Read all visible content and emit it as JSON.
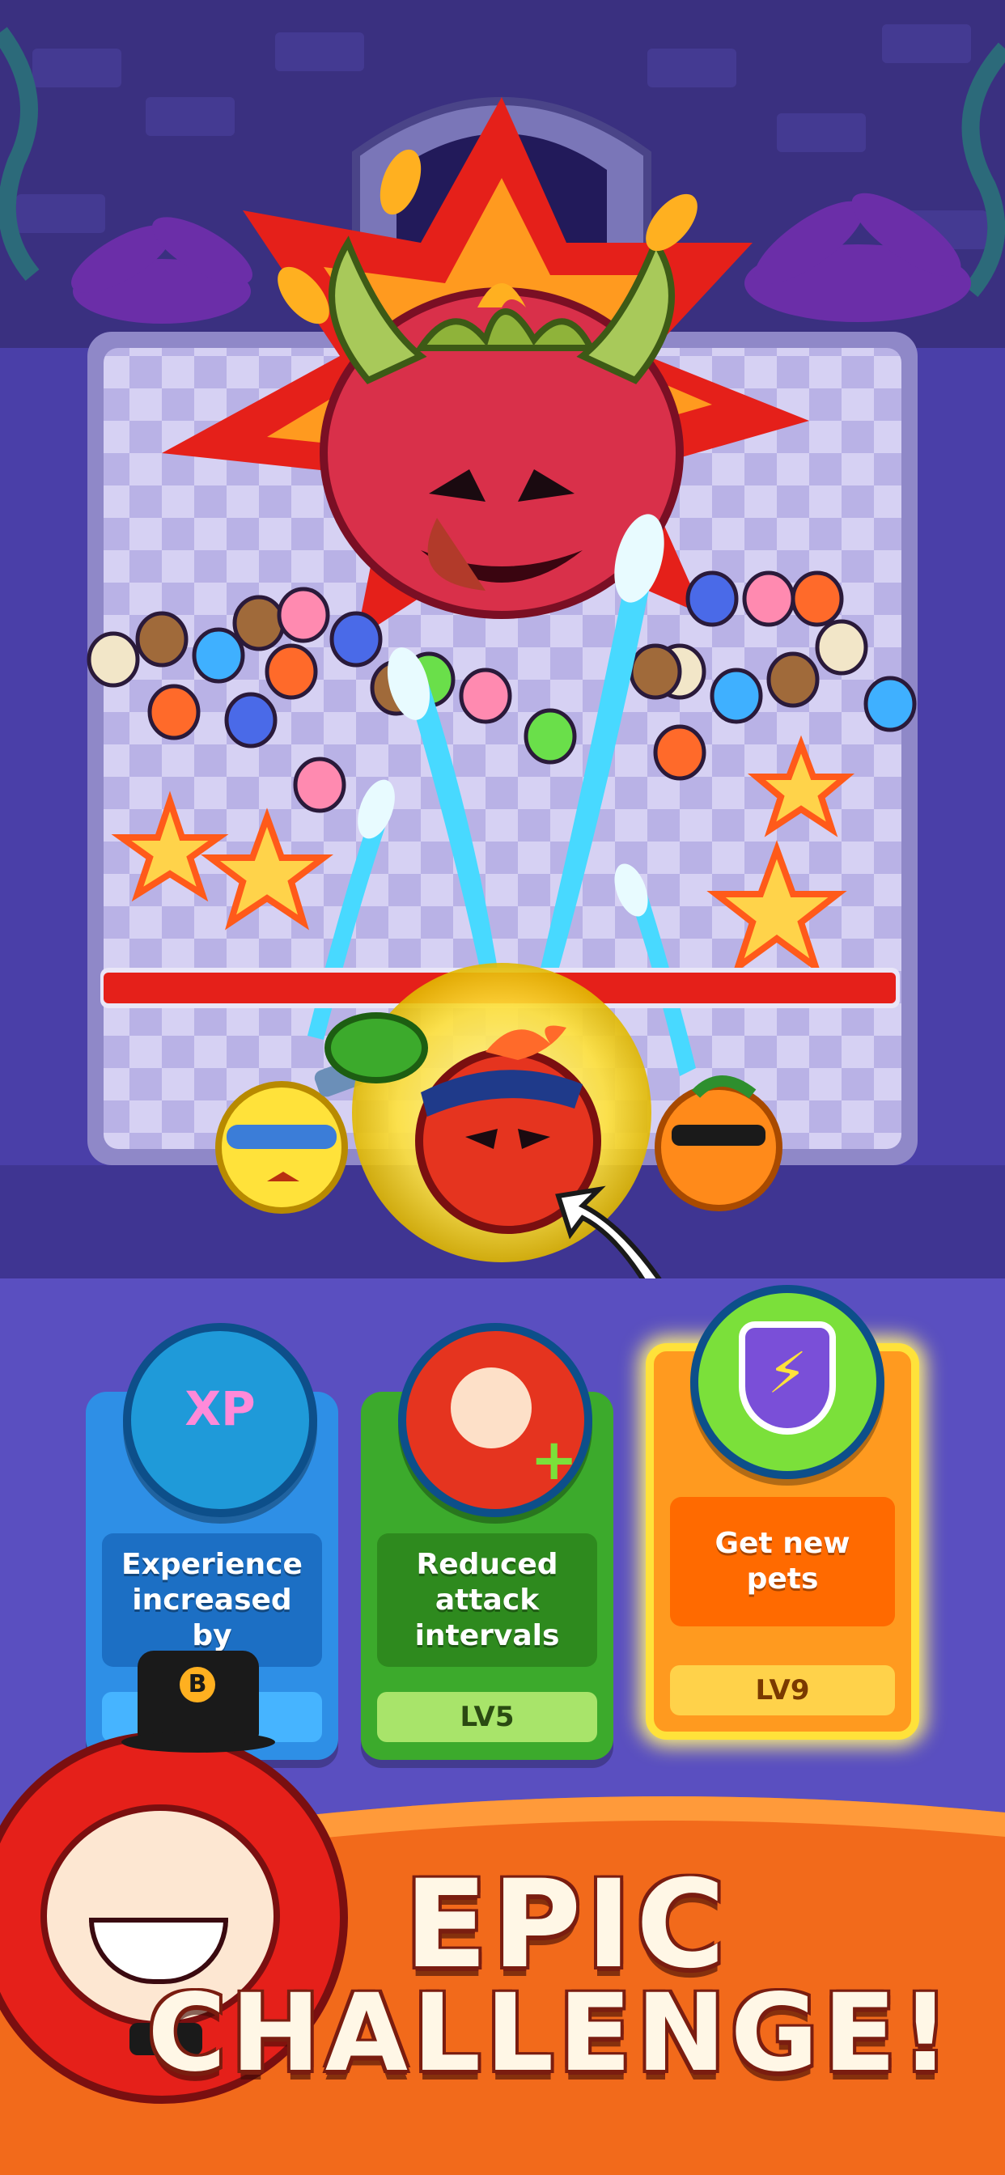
{
  "colors": {
    "background": "#4a3fa8",
    "boss_red": "#d9304a",
    "card_blue": "#2e8fe6",
    "card_green": "#3caa2c",
    "card_orange": "#ff9a1f",
    "highlight_yellow": "#ffe23a",
    "banner_orange": "#f26a1b"
  },
  "boss": {
    "name": "dragon-fruit-boss",
    "health_fraction": 0.999
  },
  "heroes": [
    {
      "name": "lemon-hero",
      "icon": "lemon-goggles"
    },
    {
      "name": "tomato-hero",
      "icon": "tomato-bandana",
      "selected": true
    },
    {
      "name": "orange-hero",
      "icon": "orange-sunglasses"
    }
  ],
  "skills": [
    {
      "id": "xp",
      "icon": "xp-arrows-icon",
      "label": "Experience increased by",
      "level": "",
      "color": "#2e8fe6"
    },
    {
      "id": "attack",
      "icon": "sword-hero-icon",
      "label": "Reduced attack intervals",
      "level": "LV5",
      "color": "#3caa2c"
    },
    {
      "id": "pets",
      "icon": "lightning-shield-icon",
      "label": "Get new pets",
      "level": "LV9",
      "color": "#ff9a1f",
      "highlighted": true
    }
  ],
  "mascot": {
    "hat_letter": "B"
  },
  "banner": {
    "line1": "EPIC",
    "line2": "CHALLENGE!"
  }
}
